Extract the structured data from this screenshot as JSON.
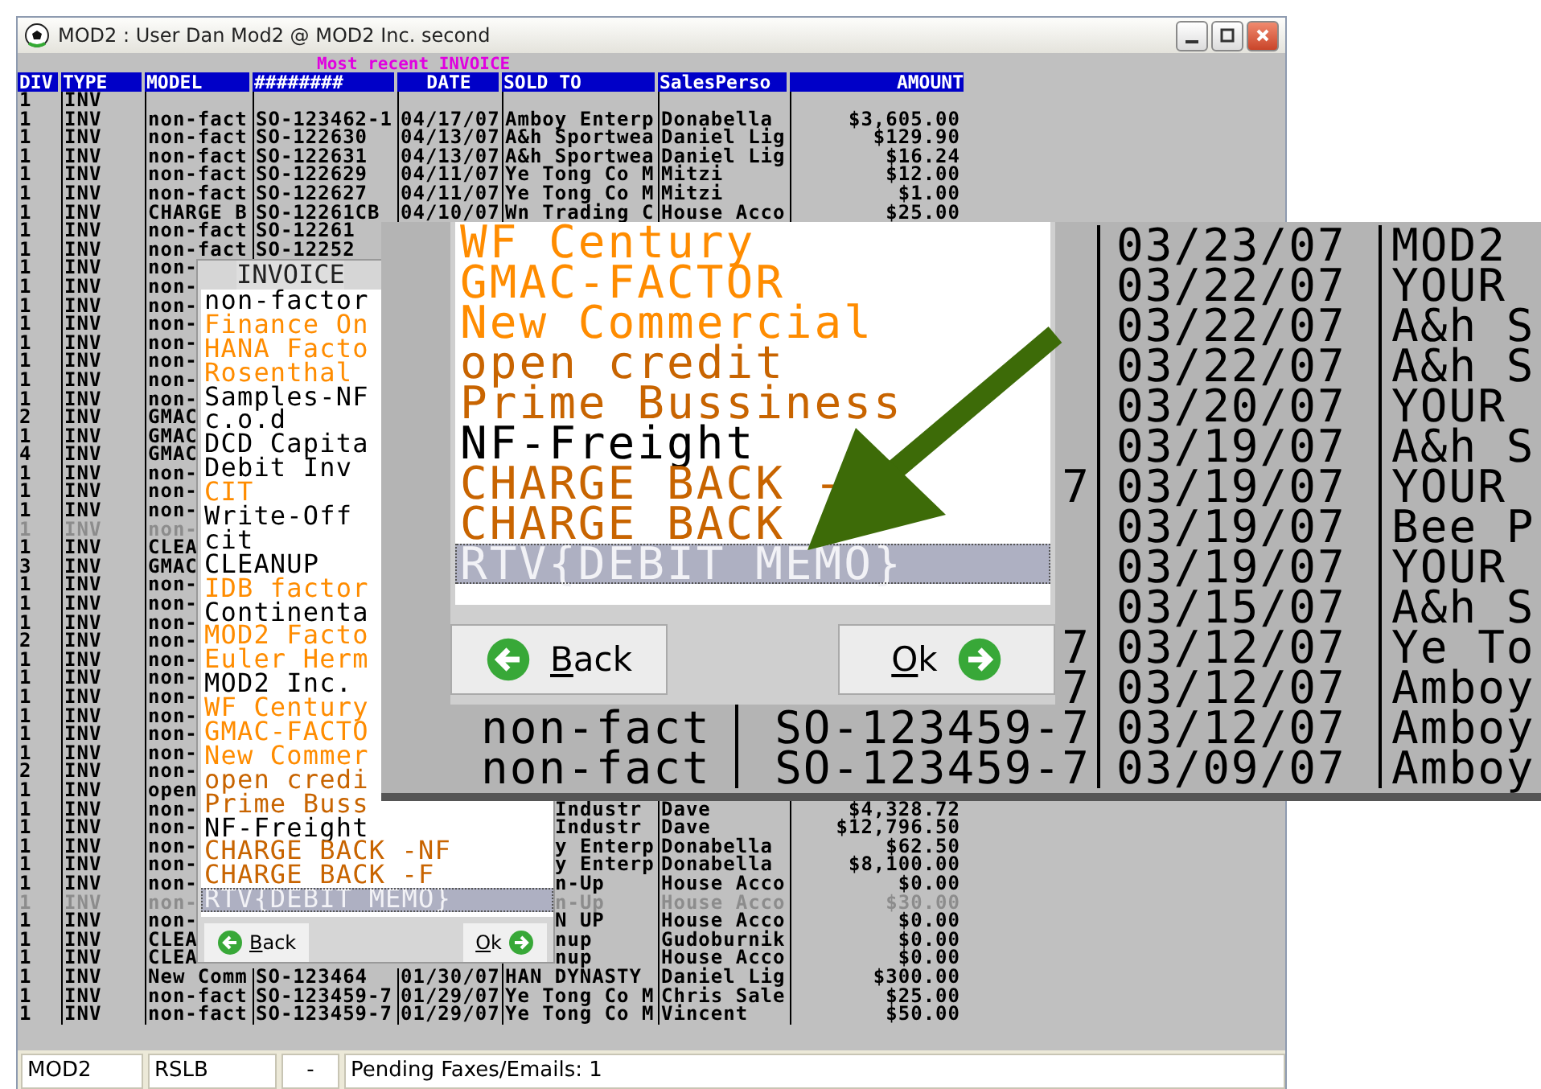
{
  "window": {
    "title": "MOD2 : User Dan Mod2 @ MOD2 Inc. second"
  },
  "table": {
    "caption": "Most recent INVOICE",
    "columns": [
      "DIV",
      "TYPE",
      "MODEL",
      "########",
      "DATE",
      "SOLD TO",
      "SalesPerso",
      "AMOUNT"
    ],
    "rows": [
      {
        "div": "1",
        "type": "INV",
        "kind": "full",
        "dimmed": false
      },
      {
        "div": "1",
        "type": "INV",
        "model": "non-fact",
        "number": "SO-123462-1",
        "date": "04/17/07",
        "sold_to": "Amboy Enterp",
        "salesperson": "Donabella",
        "amount": "$3,605.00",
        "kind": "full",
        "dimmed": false
      },
      {
        "div": "1",
        "type": "INV",
        "model": "non-fact",
        "number": "SO-122630",
        "date": "04/13/07",
        "sold_to": "A&h Sportwea",
        "salesperson": "Daniel Lig",
        "amount": "$129.90",
        "kind": "full",
        "dimmed": false
      },
      {
        "div": "1",
        "type": "INV",
        "model": "non-fact",
        "number": "SO-122631",
        "date": "04/13/07",
        "sold_to": "A&h Sportwea",
        "salesperson": "Daniel Lig",
        "amount": "$16.24",
        "kind": "full",
        "dimmed": false
      },
      {
        "div": "1",
        "type": "INV",
        "model": "non-fact",
        "number": "SO-122629",
        "date": "04/11/07",
        "sold_to": "Ye Tong Co M",
        "salesperson": "Mitzi",
        "amount": "$12.00",
        "kind": "full",
        "dimmed": false
      },
      {
        "div": "1",
        "type": "INV",
        "model": "non-fact",
        "number": "SO-122627",
        "date": "04/11/07",
        "sold_to": "Ye Tong Co M",
        "salesperson": "Mitzi",
        "amount": "$1.00",
        "kind": "full",
        "dimmed": false
      },
      {
        "div": "1",
        "type": "INV",
        "model": "CHARGE B",
        "number": "SO-12261CB",
        "date": "04/10/07",
        "sold_to": "Wn Trading C",
        "salesperson": "House Acco",
        "amount": "$25.00",
        "kind": "full",
        "dimmed": false
      },
      {
        "div": "1",
        "type": "INV",
        "model": "non-fact",
        "number": "SO-12261",
        "kind": "mid",
        "dimmed": false
      },
      {
        "div": "1",
        "type": "INV",
        "model": "non-fact",
        "number": "SO-12252",
        "kind": "mid",
        "dimmed": false
      },
      {
        "div": "1",
        "type": "INV",
        "model": "non-",
        "kind": "left",
        "dimmed": false
      },
      {
        "div": "1",
        "type": "INV",
        "model": "non-",
        "kind": "left",
        "dimmed": false
      },
      {
        "div": "1",
        "type": "INV",
        "model": "non-",
        "kind": "left",
        "dimmed": false
      },
      {
        "div": "1",
        "type": "INV",
        "model": "non-",
        "kind": "left",
        "dimmed": false
      },
      {
        "div": "1",
        "type": "INV",
        "model": "non-",
        "kind": "left",
        "dimmed": false
      },
      {
        "div": "1",
        "type": "INV",
        "model": "non-",
        "kind": "left",
        "dimmed": false
      },
      {
        "div": "1",
        "type": "INV",
        "model": "non-",
        "kind": "left",
        "dimmed": false
      },
      {
        "div": "1",
        "type": "INV",
        "model": "non-",
        "kind": "left",
        "dimmed": false
      },
      {
        "div": "2",
        "type": "INV",
        "model": "GMAC",
        "kind": "left",
        "dimmed": false
      },
      {
        "div": "1",
        "type": "INV",
        "model": "GMAC",
        "kind": "left",
        "dimmed": false
      },
      {
        "div": "4",
        "type": "INV",
        "model": "GMAC",
        "kind": "left",
        "dimmed": false
      },
      {
        "div": "1",
        "type": "INV",
        "model": "non-",
        "kind": "left",
        "dimmed": false
      },
      {
        "div": "1",
        "type": "INV",
        "model": "non-",
        "kind": "left",
        "dimmed": false
      },
      {
        "div": "1",
        "type": "INV",
        "model": "non-",
        "kind": "left",
        "dimmed": false
      },
      {
        "div": "1",
        "type": "INV",
        "model": "non-",
        "kind": "left",
        "dimmed": true
      },
      {
        "div": "1",
        "type": "INV",
        "model": "CLEA",
        "kind": "left",
        "dimmed": false
      },
      {
        "div": "3",
        "type": "INV",
        "model": "GMAC",
        "kind": "left",
        "dimmed": false
      },
      {
        "div": "1",
        "type": "INV",
        "model": "non-",
        "kind": "left",
        "dimmed": false
      },
      {
        "div": "1",
        "type": "INV",
        "model": "non-",
        "kind": "left",
        "dimmed": false
      },
      {
        "div": "1",
        "type": "INV",
        "model": "non-",
        "kind": "left",
        "dimmed": false
      },
      {
        "div": "2",
        "type": "INV",
        "model": "non-",
        "kind": "left",
        "dimmed": false
      },
      {
        "div": "1",
        "type": "INV",
        "model": "non-",
        "kind": "left",
        "dimmed": false
      },
      {
        "div": "1",
        "type": "INV",
        "model": "non-",
        "kind": "left",
        "dimmed": false
      },
      {
        "div": "1",
        "type": "INV",
        "model": "non-",
        "kind": "left",
        "dimmed": false
      },
      {
        "div": "1",
        "type": "INV",
        "model": "non-",
        "kind": "left",
        "dimmed": false
      },
      {
        "div": "1",
        "type": "INV",
        "model": "non-",
        "kind": "left",
        "dimmed": false
      },
      {
        "div": "1",
        "type": "INV",
        "model": "non-",
        "kind": "left",
        "dimmed": false
      },
      {
        "div": "2",
        "type": "INV",
        "model": "non-",
        "kind": "left",
        "dimmed": false
      },
      {
        "div": "1",
        "type": "INV",
        "model": "open",
        "kind": "left",
        "dimmed": false
      },
      {
        "div": "1",
        "type": "INV",
        "model": "non-",
        "sold_to": "Industr",
        "salesperson": "Dave",
        "amount": "$4,328.72",
        "kind": "right",
        "dimmed": false
      },
      {
        "div": "1",
        "type": "INV",
        "model": "non-",
        "sold_to": "Industr",
        "salesperson": "Dave",
        "amount": "$12,796.50",
        "kind": "right",
        "dimmed": false
      },
      {
        "div": "1",
        "type": "INV",
        "model": "non-",
        "sold_to": "y Enterp",
        "salesperson": "Donabella",
        "amount": "$62.50",
        "kind": "right",
        "dimmed": false
      },
      {
        "div": "1",
        "type": "INV",
        "model": "non-",
        "sold_to": "y Enterp",
        "salesperson": "Donabella",
        "amount": "$8,100.00",
        "kind": "right",
        "dimmed": false
      },
      {
        "div": "1",
        "type": "INV",
        "model": "non-",
        "sold_to": "n-Up",
        "salesperson": "House Acco",
        "amount": "$0.00",
        "kind": "right",
        "dimmed": false
      },
      {
        "div": "1",
        "type": "INV",
        "model": "non-",
        "sold_to": "n-Up",
        "salesperson": "House Acco",
        "amount": "$30.00",
        "kind": "right",
        "dimmed": true
      },
      {
        "div": "1",
        "type": "INV",
        "model": "non-",
        "sold_to": "N UP",
        "salesperson": "House Acco",
        "amount": "$0.00",
        "kind": "right",
        "dimmed": false
      },
      {
        "div": "1",
        "type": "INV",
        "model": "CLEA",
        "sold_to": "nup",
        "salesperson": "Gudoburnik",
        "amount": "$0.00",
        "kind": "right",
        "dimmed": false
      },
      {
        "div": "1",
        "type": "INV",
        "model": "CLEA",
        "sold_to": "nup",
        "salesperson": "House Acco",
        "amount": "$0.00",
        "kind": "right",
        "dimmed": false
      },
      {
        "div": "1",
        "type": "INV",
        "model": "New Comm",
        "number": "SO-123464",
        "date": "01/30/07",
        "sold_to": "HAN DYNASTY",
        "salesperson": "Daniel Lig",
        "amount": "$300.00",
        "kind": "full",
        "dimmed": false
      },
      {
        "div": "1",
        "type": "INV",
        "model": "non-fact",
        "number": "SO-123459-7",
        "date": "01/29/07",
        "sold_to": "Ye Tong Co M",
        "salesperson": "Chris Sale",
        "amount": "$25.00",
        "kind": "full",
        "dimmed": false
      },
      {
        "div": "1",
        "type": "INV",
        "model": "non-fact",
        "number": "SO-123459-7",
        "date": "01/29/07",
        "sold_to": "Ye Tong Co M",
        "salesperson": "Vincent",
        "amount": "$50.00",
        "kind": "full",
        "dimmed": false
      }
    ]
  },
  "invoice_dialog": {
    "title": "INVOICE",
    "items": [
      {
        "label": "non-factor",
        "color": "#000000",
        "selected": false
      },
      {
        "label": "Finance On",
        "color": "#ff8c00",
        "selected": false
      },
      {
        "label": "HANA Facto",
        "color": "#ff8c00",
        "selected": false
      },
      {
        "label": "Rosenthal",
        "color": "#ff8c00",
        "selected": false
      },
      {
        "label": "Samples-NF",
        "color": "#000000",
        "selected": false
      },
      {
        "label": "c.o.d",
        "color": "#000000",
        "selected": false
      },
      {
        "label": "DCD Capita",
        "color": "#000000",
        "selected": false
      },
      {
        "label": "Debit Inv",
        "color": "#000000",
        "selected": false
      },
      {
        "label": "CIT",
        "color": "#ff8c00",
        "selected": false
      },
      {
        "label": "Write-Off",
        "color": "#000000",
        "selected": false
      },
      {
        "label": "cit",
        "color": "#000000",
        "selected": false
      },
      {
        "label": "CLEANUP",
        "color": "#000000",
        "selected": false
      },
      {
        "label": "IDB factor",
        "color": "#ff8c00",
        "selected": false
      },
      {
        "label": "Continenta",
        "color": "#000000",
        "selected": false
      },
      {
        "label": "MOD2 Facto",
        "color": "#ff8c00",
        "selected": false
      },
      {
        "label": "Euler Herm",
        "color": "#ff8c00",
        "selected": false
      },
      {
        "label": "MOD2 Inc.",
        "color": "#000000",
        "selected": false
      },
      {
        "label": "WF Century",
        "color": "#ff8c00",
        "selected": false
      },
      {
        "label": "GMAC-FACTO",
        "color": "#ff8c00",
        "selected": false
      },
      {
        "label": "New Commer",
        "color": "#ff8c00",
        "selected": false
      },
      {
        "label": "open credi",
        "color": "#c86400",
        "selected": false
      },
      {
        "label": "Prime Buss",
        "color": "#c86400",
        "selected": false
      },
      {
        "label": "NF-Freight",
        "color": "#000000",
        "selected": false
      },
      {
        "label": "CHARGE BACK -NF",
        "color": "#c86400",
        "selected": false
      },
      {
        "label": "CHARGE BACK -F",
        "color": "#c86400",
        "selected": false
      },
      {
        "label": "RTV{DEBIT MEMO}",
        "selected": true
      }
    ],
    "buttons": [
      {
        "label": "Back",
        "kind": "back"
      },
      {
        "label": "Ok",
        "kind": "ok"
      }
    ]
  },
  "zoom_callout": {
    "items": [
      {
        "label": "WF Century",
        "color": "#ff8c00",
        "selected": false
      },
      {
        "label": "GMAC-FACTOR",
        "color": "#ff8c00",
        "selected": false
      },
      {
        "label": "New Commercial",
        "color": "#ff8c00",
        "selected": false
      },
      {
        "label": "open credit",
        "color": "#c86400",
        "selected": false
      },
      {
        "label": "Prime Bussiness",
        "color": "#c86400",
        "selected": false
      },
      {
        "label": "NF-Freight",
        "color": "#000000",
        "selected": false
      },
      {
        "label": "CHARGE BACK -",
        "color": "#c86400",
        "selected": false
      },
      {
        "label": "CHARGE BACK",
        "color": "#c86400",
        "selected": false
      },
      {
        "label": "RTV{DEBIT MEMO}",
        "selected": true
      }
    ],
    "buttons": [
      {
        "label": "Back",
        "kind": "back"
      },
      {
        "label": "Ok",
        "kind": "ok"
      }
    ],
    "rows": [
      {
        "date": "03/23/07",
        "sold_to": "MOD2"
      },
      {
        "date": "03/22/07",
        "sold_to": "YOUR"
      },
      {
        "date": "03/22/07",
        "sold_to": "A&h S"
      },
      {
        "date": "03/22/07",
        "sold_to": "A&h S"
      },
      {
        "date": "03/20/07",
        "sold_to": "YOUR"
      },
      {
        "date": "03/19/07",
        "sold_to": "A&h S"
      },
      {
        "number": "7",
        "date": "03/19/07",
        "sold_to": "YOUR"
      },
      {
        "date": "03/19/07",
        "sold_to": "Bee P"
      },
      {
        "date": "03/19/07",
        "sold_to": "YOUR"
      },
      {
        "date": "03/15/07",
        "sold_to": "A&h S"
      },
      {
        "number": "7",
        "date": "03/12/07",
        "sold_to": "Ye To"
      },
      {
        "number": "7",
        "date": "03/12/07",
        "sold_to": "Amboy"
      },
      {
        "model": "non-fact",
        "number": "SO-123459-7",
        "date": "03/12/07",
        "sold_to": "Amboy"
      },
      {
        "model": "non-fact",
        "number": "SO-123459-7",
        "date": "03/09/07",
        "sold_to": "Amboy"
      }
    ]
  },
  "status_bar": [
    "MOD2",
    "RSLB",
    "-",
    "Pending Faxes/Emails: 1"
  ]
}
